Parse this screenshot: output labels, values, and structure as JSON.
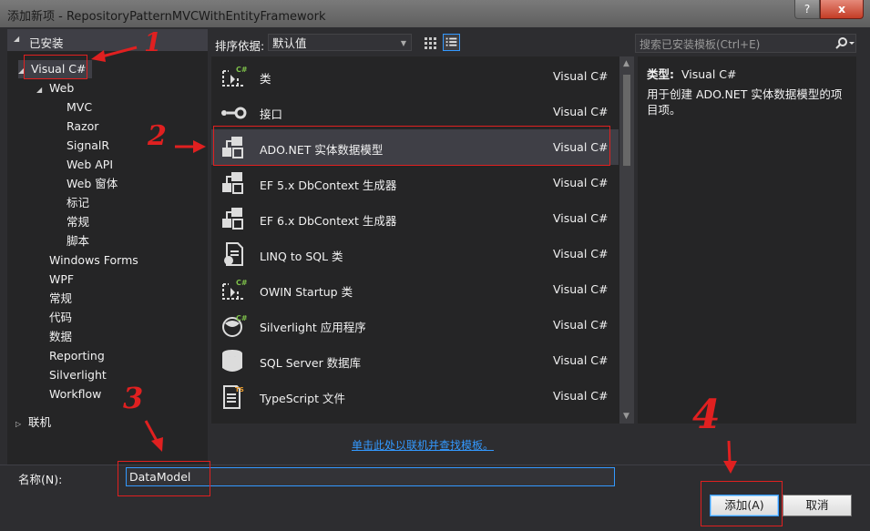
{
  "window": {
    "title": "添加新项 - RepositoryPatternMVCWithEntityFramework",
    "help_label": "?",
    "close_label": "x"
  },
  "tree": {
    "installed_label": "已安装",
    "visual_csharp": "Visual C#",
    "web": "Web",
    "web_children": [
      "MVC",
      "Razor",
      "SignalR",
      "Web API",
      "Web 窗体",
      "标记",
      "常规",
      "脚本"
    ],
    "csharp_children": [
      "Windows Forms",
      "WPF",
      "常规",
      "代码",
      "数据",
      "Reporting",
      "Silverlight",
      "Workflow"
    ],
    "online_label": "联机"
  },
  "sortbar": {
    "label": "排序依据:",
    "selected": "默认值"
  },
  "templates": [
    {
      "name": "类",
      "lang": "Visual C#",
      "icon": "class-icon"
    },
    {
      "name": "接口",
      "lang": "Visual C#",
      "icon": "interface-icon"
    },
    {
      "name": "ADO.NET 实体数据模型",
      "lang": "Visual C#",
      "icon": "entity-model-icon"
    },
    {
      "name": "EF 5.x DbContext 生成器",
      "lang": "Visual C#",
      "icon": "ef-generator-icon"
    },
    {
      "name": "EF 6.x DbContext 生成器",
      "lang": "Visual C#",
      "icon": "ef-generator-icon"
    },
    {
      "name": "LINQ to SQL 类",
      "lang": "Visual C#",
      "icon": "linq-icon"
    },
    {
      "name": "OWIN Startup 类",
      "lang": "Visual C#",
      "icon": "owin-class-icon"
    },
    {
      "name": "Silverlight 应用程序",
      "lang": "Visual C#",
      "icon": "silverlight-icon"
    },
    {
      "name": "SQL Server 数据库",
      "lang": "Visual C#",
      "icon": "database-icon"
    },
    {
      "name": "TypeScript 文件",
      "lang": "Visual C#",
      "icon": "typescript-file-icon"
    }
  ],
  "online_link": "单击此处以联机并查找模板。",
  "search": {
    "placeholder": "搜索已安装模板(Ctrl+E)"
  },
  "details": {
    "type_label": "类型:",
    "type_value": "Visual C#",
    "description": "用于创建 ADO.NET 实体数据模型的项目项。"
  },
  "name_field": {
    "label": "名称(N):",
    "value": "DataModel"
  },
  "buttons": {
    "add": "添加(A)",
    "cancel": "取消"
  },
  "annotations": [
    "1",
    "2",
    "3",
    "4"
  ],
  "colors": {
    "accent": "#3399ff",
    "annotation_red": "#e02020",
    "background": "#2d2d30"
  }
}
